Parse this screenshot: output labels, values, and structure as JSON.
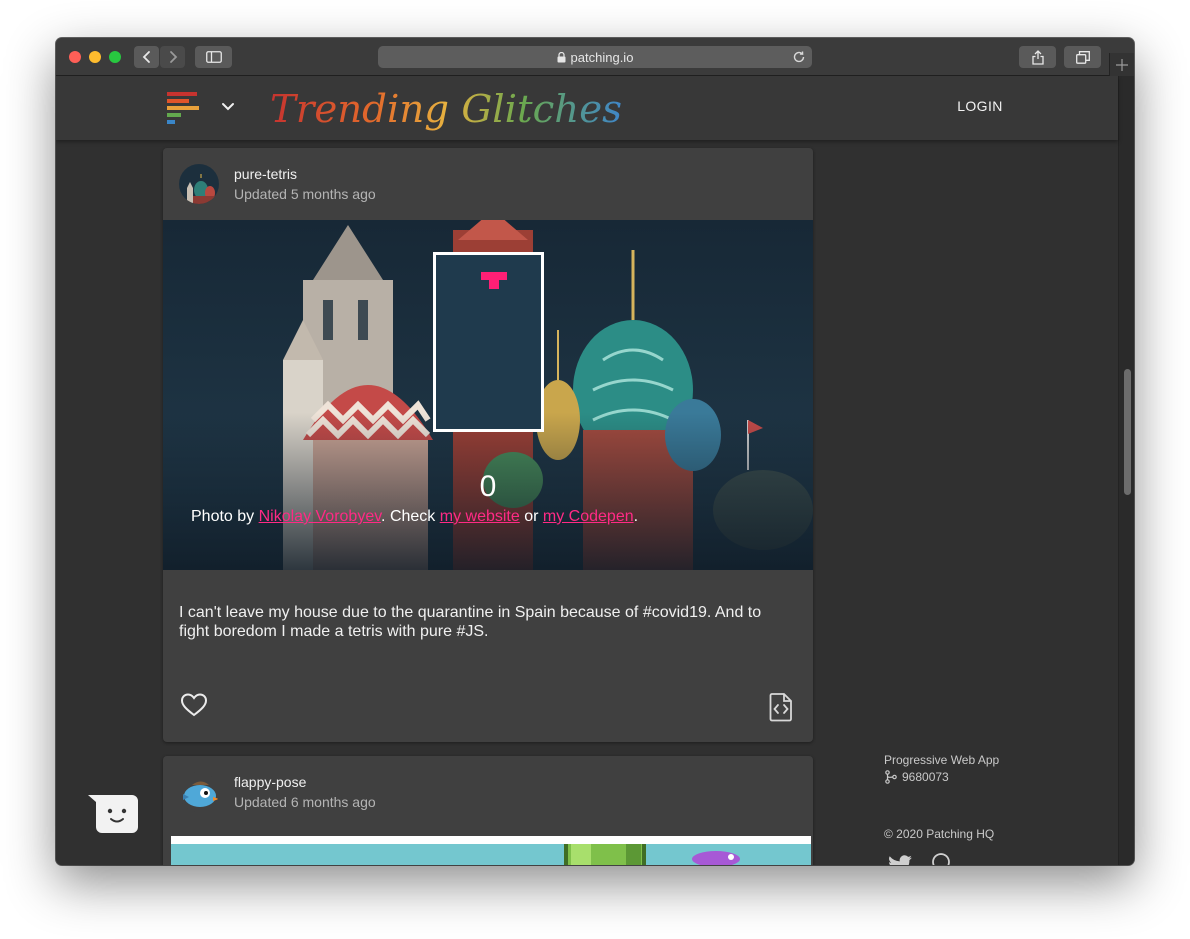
{
  "browser": {
    "url": "patching.io"
  },
  "header": {
    "brand": "Trending Glitches",
    "login_label": "LOGIN"
  },
  "posts": [
    {
      "name": "pure-tetris",
      "updated": "Updated 5 months ago",
      "preview": {
        "score": "0",
        "credit_prefix": "Photo by ",
        "credit_author": "Nikolay Vorobyev",
        "credit_mid": ". Check ",
        "credit_site": "my website",
        "credit_or": " or ",
        "credit_codepen": "my Codepen",
        "credit_end": "."
      },
      "description": "I can't leave my house due to the quarantine in Spain because of #covid19. And to fight boredom I made a tetris with pure #JS."
    },
    {
      "name": "flappy-pose",
      "updated": "Updated 6 months ago"
    }
  ],
  "aside": {
    "pwa": "Progressive Web App",
    "build": "9680073",
    "copyright": "© 2020 Patching HQ"
  },
  "colors": {
    "accent": "#ff2a85",
    "background": "#303030",
    "card": "#404040"
  }
}
